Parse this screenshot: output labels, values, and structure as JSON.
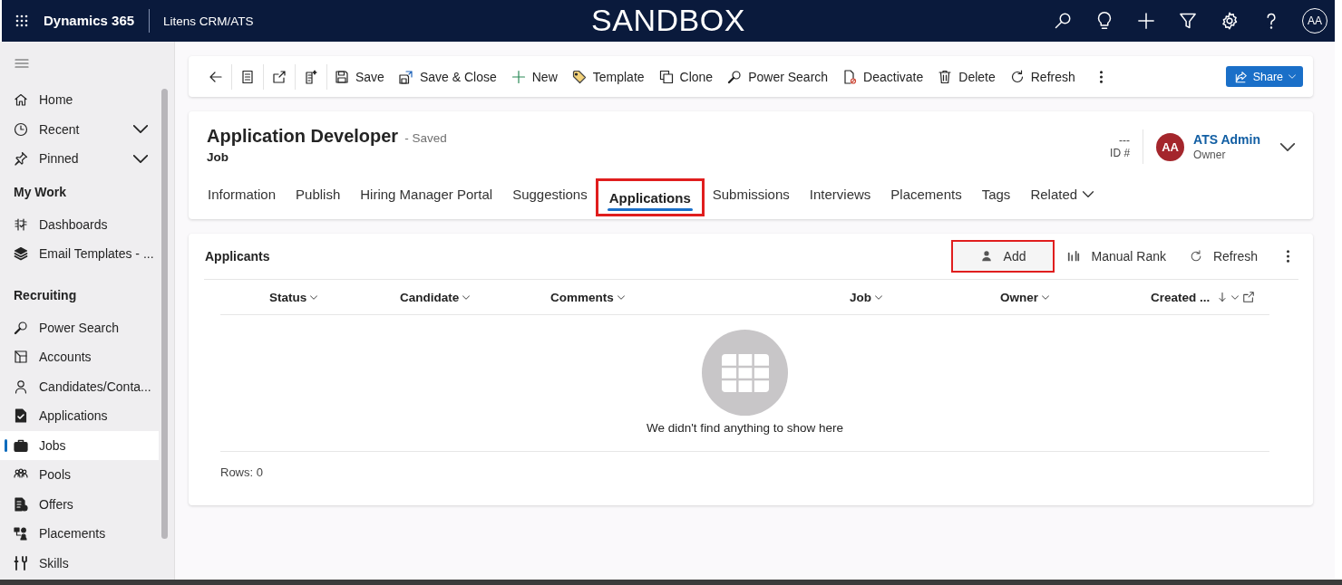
{
  "top_bar": {
    "app_name": "Dynamics 365",
    "area": "Litens CRM/ATS",
    "banner": "SANDBOX",
    "avatar": "AA"
  },
  "sidebar": {
    "sections": [
      {
        "items": [
          {
            "label": "Home",
            "kind": "link",
            "selected": false
          },
          {
            "label": "Recent",
            "kind": "flyout",
            "selected": false
          },
          {
            "label": "Pinned",
            "kind": "flyout",
            "selected": false
          }
        ]
      },
      {
        "title": "My Work",
        "items": [
          {
            "label": "Dashboards",
            "kind": "link",
            "selected": false
          },
          {
            "label": "Email Templates - ...",
            "kind": "link",
            "selected": false
          }
        ]
      },
      {
        "title": "Recruiting",
        "items": [
          {
            "label": "Power Search",
            "kind": "link",
            "selected": false
          },
          {
            "label": "Accounts",
            "kind": "link",
            "selected": false
          },
          {
            "label": "Candidates/Conta...",
            "kind": "link",
            "selected": false
          },
          {
            "label": "Applications",
            "kind": "link",
            "selected": false
          },
          {
            "label": "Jobs",
            "kind": "link",
            "selected": true
          },
          {
            "label": "Pools",
            "kind": "link",
            "selected": false
          },
          {
            "label": "Offers",
            "kind": "link",
            "selected": false
          },
          {
            "label": "Placements",
            "kind": "link",
            "selected": false
          },
          {
            "label": "Skills",
            "kind": "link",
            "selected": false
          }
        ]
      }
    ]
  },
  "command_bar": {
    "buttons": [
      "Save",
      "Save & Close",
      "New",
      "Template",
      "Clone",
      "Power Search",
      "Deactivate",
      "Delete",
      "Refresh"
    ],
    "share": "Share"
  },
  "record": {
    "title": "Application Developer",
    "status": "- Saved",
    "entity": "Job",
    "id_value": "---",
    "id_label": "ID #",
    "owner_initials": "AA",
    "owner_name": "ATS Admin",
    "owner_role": "Owner"
  },
  "tabs": [
    {
      "label": "Information",
      "selected": false,
      "highlighted": false
    },
    {
      "label": "Publish",
      "selected": false,
      "highlighted": false
    },
    {
      "label": "Hiring Manager Portal",
      "selected": false,
      "highlighted": false
    },
    {
      "label": "Suggestions",
      "selected": false,
      "highlighted": false
    },
    {
      "label": "Applications",
      "selected": true,
      "highlighted": true
    },
    {
      "label": "Submissions",
      "selected": false,
      "highlighted": false
    },
    {
      "label": "Interviews",
      "selected": false,
      "highlighted": false
    },
    {
      "label": "Placements",
      "selected": false,
      "highlighted": false
    },
    {
      "label": "Tags",
      "selected": false,
      "highlighted": false
    },
    {
      "label": "Related",
      "selected": false,
      "highlighted": false
    }
  ],
  "subgrid": {
    "title": "Applicants",
    "commands": [
      {
        "label": "Add",
        "highlighted": true
      },
      {
        "label": "Manual Rank",
        "highlighted": false
      },
      {
        "label": "Refresh",
        "highlighted": false
      }
    ],
    "columns": [
      {
        "label": "Status",
        "sorted": false
      },
      {
        "label": "Candidate",
        "sorted": false
      },
      {
        "label": "Comments",
        "sorted": false
      },
      {
        "label": "Job",
        "sorted": false
      },
      {
        "label": "Owner",
        "sorted": false
      },
      {
        "label": "Created ...",
        "sorted": true
      }
    ],
    "empty_message": "We didn't find anything to show here",
    "footer": "Rows: 0"
  }
}
